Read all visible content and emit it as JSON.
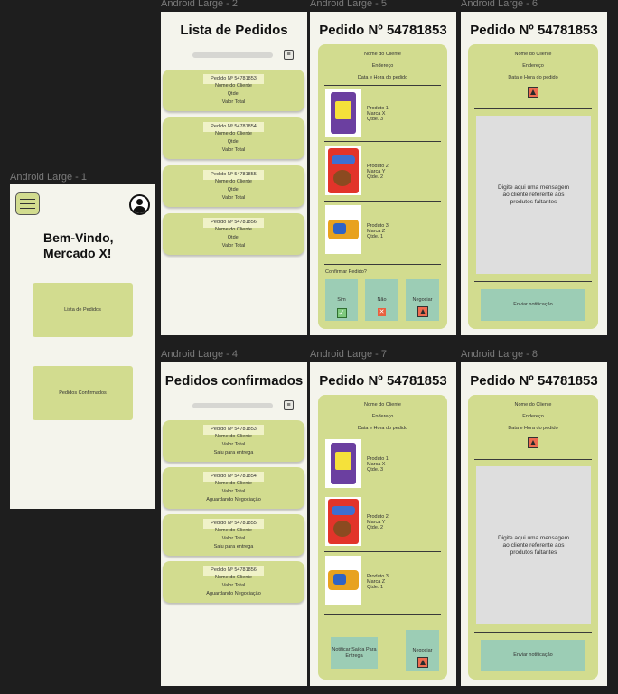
{
  "frame_labels": {
    "f1": "Android Large - 1",
    "f2": "Android Large - 2",
    "f4": "Android Large - 4",
    "f5": "Android Large - 5",
    "f6": "Android Large - 6",
    "f7": "Android Large - 7",
    "f8": "Android Large - 8"
  },
  "home": {
    "welcome_line1": "Bem-Vindo,",
    "welcome_line2": "Mercado X!",
    "btn_orders": "Lista de Pedidos",
    "btn_confirmed": "Pedidos Confirmados"
  },
  "orders_list": {
    "title": "Lista de Pedidos",
    "filter_icon": "filter-icon",
    "cards": [
      {
        "number": "Pedido Nº 54781853",
        "client": "Nome do Cliente",
        "qty": "Qtde.",
        "total": "Valor Total"
      },
      {
        "number": "Pedido Nº 54781854",
        "client": "Nome do Cliente",
        "qty": "Qtde.",
        "total": "Valor Total"
      },
      {
        "number": "Pedido Nº 54781855",
        "client": "Nome do Cliente",
        "qty": "Qtde.",
        "total": "Valor Total"
      },
      {
        "number": "Pedido Nº 54781856",
        "client": "Nome do Cliente",
        "qty": "Qtde.",
        "total": "Valor Total"
      }
    ]
  },
  "confirmed_list": {
    "title": "Pedidos confirmados",
    "cards": [
      {
        "number": "Pedido Nº 54781853",
        "client": "Nome do Cliente",
        "total": "Valor Total",
        "status": "Saiu para entrega"
      },
      {
        "number": "Pedido Nº 54781854",
        "client": "Nome do Cliente",
        "total": "Valor Total",
        "status": "Aguardando Negociação"
      },
      {
        "number": "Pedido Nº 54781855",
        "client": "Nome do Cliente",
        "total": "Valor Total",
        "status": "Saiu para entrega"
      },
      {
        "number": "Pedido Nº 54781856",
        "client": "Nome do Cliente",
        "total": "Valor Total",
        "status": "Aguardando Negociação"
      }
    ]
  },
  "order_detail": {
    "title": "Pedido Nº 54781853",
    "client": "Nome do Cliente",
    "address": "Endereço",
    "datetime": "Data e Hora do pedido",
    "products": [
      {
        "name": "Produto 1",
        "brand": "Marca X",
        "qty": "Qtde. 3"
      },
      {
        "name": "Produto 2",
        "brand": "Marca Y",
        "qty": "Qtde. 2"
      },
      {
        "name": "Produto 3",
        "brand": "Marca Z",
        "qty": "Qtde. 1"
      }
    ],
    "confirm_question": "Confirmar Pedido?",
    "btn_yes": "Sim",
    "btn_no": "Não",
    "btn_negotiate": "Negociar",
    "btn_notify_exit": "Notificar Saída Para Entrega"
  },
  "negotiation": {
    "message_placeholder": "Digite aqui uma mensagem ao cliente referente aos produtos faltantes",
    "btn_send": "Enviar notificação"
  },
  "colors": {
    "panel": "#d2dc8f",
    "button_teal": "#9ccdb5",
    "background": "#f4f4ec",
    "warn": "#ed6b4f",
    "check": "#7ec97e"
  }
}
